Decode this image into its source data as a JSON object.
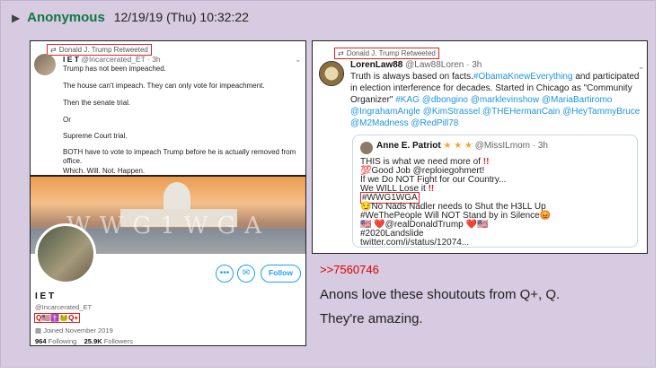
{
  "post": {
    "marker": "▶",
    "name": "Anonymous",
    "datetime": "12/19/19 (Thu) 10:32:22",
    "reply_link": ">>7560746",
    "message_lines": [
      "Anons love these shoutouts from Q+, Q.",
      "They're amazing."
    ]
  },
  "tweet1": {
    "retweet_label": "Donald J. Trump Retweeted",
    "display_name": "I E T",
    "handle_time": "@Incarcerated_ET · 3h",
    "lines": [
      "Trump has not been impeached.",
      "The house can't impeach. They can only vote for impeachment.",
      "Then the senate trial.",
      "Or",
      "Supreme Court trial.",
      "BOTH have to vote to impeach Trump before he is actually removed from",
      "office.",
      "Which. Will. Not. Happen."
    ]
  },
  "profile": {
    "banner_text": "WWG1WGA",
    "follow_label": "Follow",
    "more_glyph": "•••",
    "mail_glyph": "✉",
    "name": "I E T",
    "handle": "@Incarcerated_ET",
    "emoji_line": "Q🇺🇸✝️🐸Q+",
    "joined": "Joined November 2019",
    "following_count": "964",
    "following_label": "Following",
    "followers_count": "25.9K",
    "followers_label": "Followers"
  },
  "tweet2": {
    "retweet_label": "Donald J. Trump Retweeted",
    "display_name": "LorenLaw88",
    "handle_time": "@Law88Loren · 3h",
    "text_line1": "Truth is always based on facts.",
    "tag_line1": "#ObamaKnewEverything",
    "text_line1b": " and participated",
    "text_line2": "in election interference for decades. Started in Chicago as \"Community",
    "text_line3a": "Organizer\" ",
    "tags_line3": "#KAG @dbongino @marklevinshow @MariaBartiromo",
    "tags_line4": "@IngrahamAngle @KimStrassel @THEHermanCain @HeyTammyBruce",
    "tags_line5": "@M2Madness @RedPill78",
    "quote": {
      "display_name": "Anne E. Patriot",
      "stars": "★ ★ ★",
      "handle_time": "@MissILmom · 3h",
      "line1": "THIS is what we need more of",
      "bangs": "!!",
      "line2": "💯Good Job @reploiegohmert!",
      "line3": "If we Do NOT Fight for our Country...",
      "line4": "We WILL Lose it",
      "hashtag_boxed": "#WWG1WGA",
      "line6": "😏No Nads Nadler needs to Shut the H3LL Up",
      "line7": "#WeThePeople Will NOT Stand by in Silence😡",
      "line8": "🇺🇸 ❤️@realDonaldTrump ❤️🇺🇸",
      "line9": "#2020Landslide",
      "line10": "twitter.com/i/status/12074..."
    }
  },
  "colors": {
    "post_bg": "#d6cbe0",
    "name_green": "#117743",
    "reply_red": "#dd0000",
    "twitter_blue": "#1b95e0"
  }
}
